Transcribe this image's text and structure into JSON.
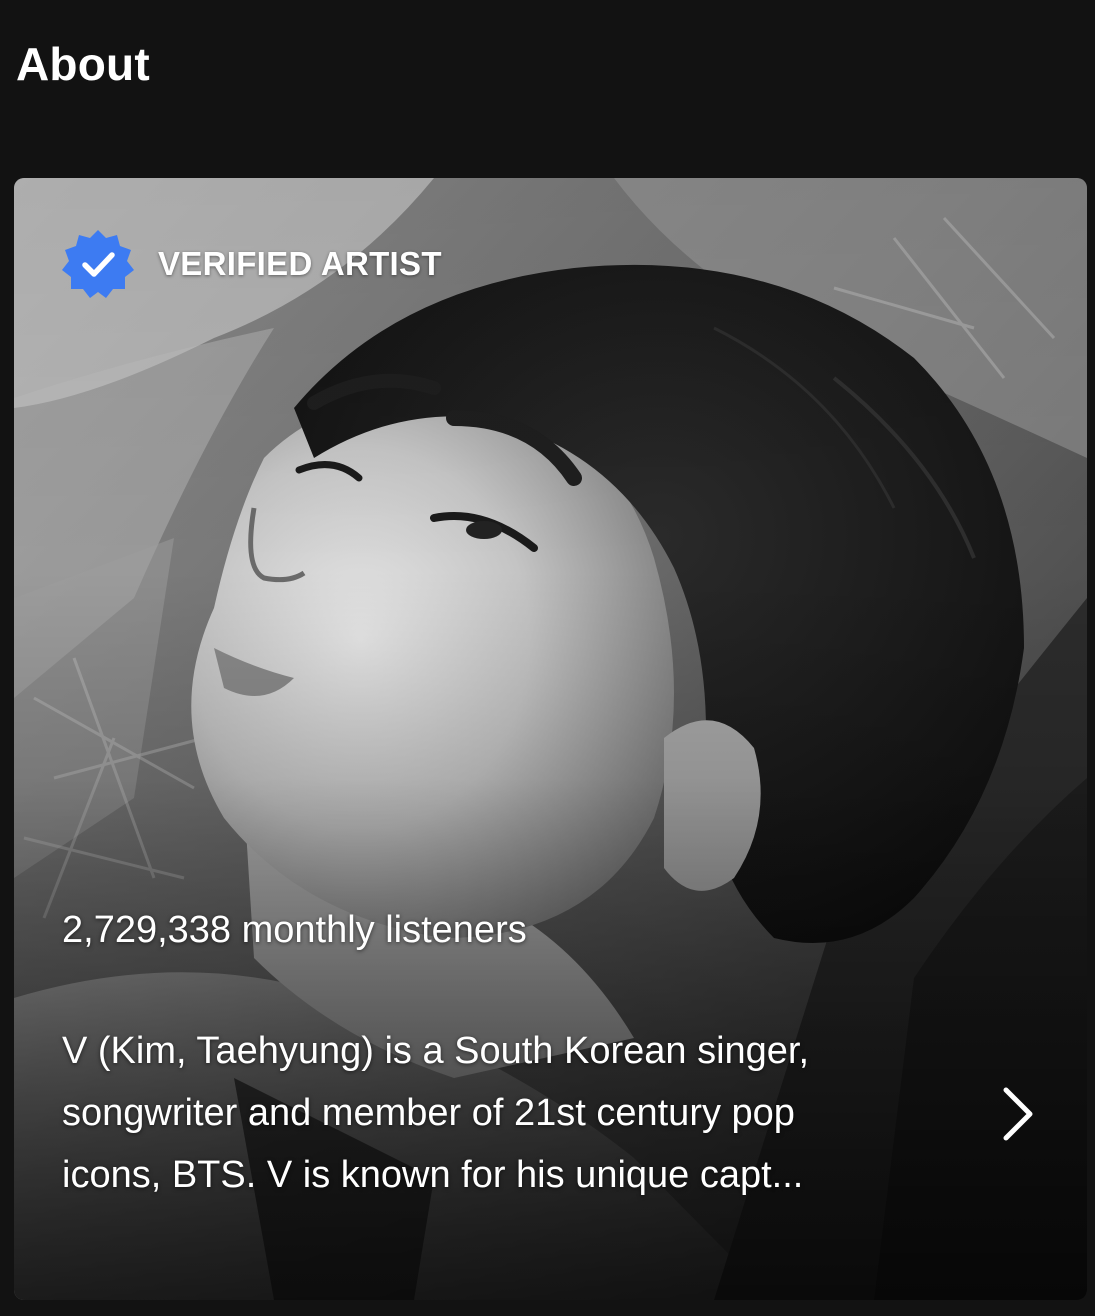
{
  "section": {
    "title": "About"
  },
  "card": {
    "verified_label": "VERIFIED ARTIST",
    "monthly_listeners": "2,729,338 monthly listeners",
    "bio_lines": [
      "V (Kim, Taehyung) is a South Korean singer,",
      "songwriter and member of 21st century pop",
      "icons, BTS. V is known for his unique capt..."
    ],
    "icons": {
      "badge": "verified-badge-icon",
      "more": "chevron-right-icon"
    }
  },
  "colors": {
    "background": "#121212",
    "verified_blue": "#3d7bf2",
    "text": "#ffffff"
  }
}
